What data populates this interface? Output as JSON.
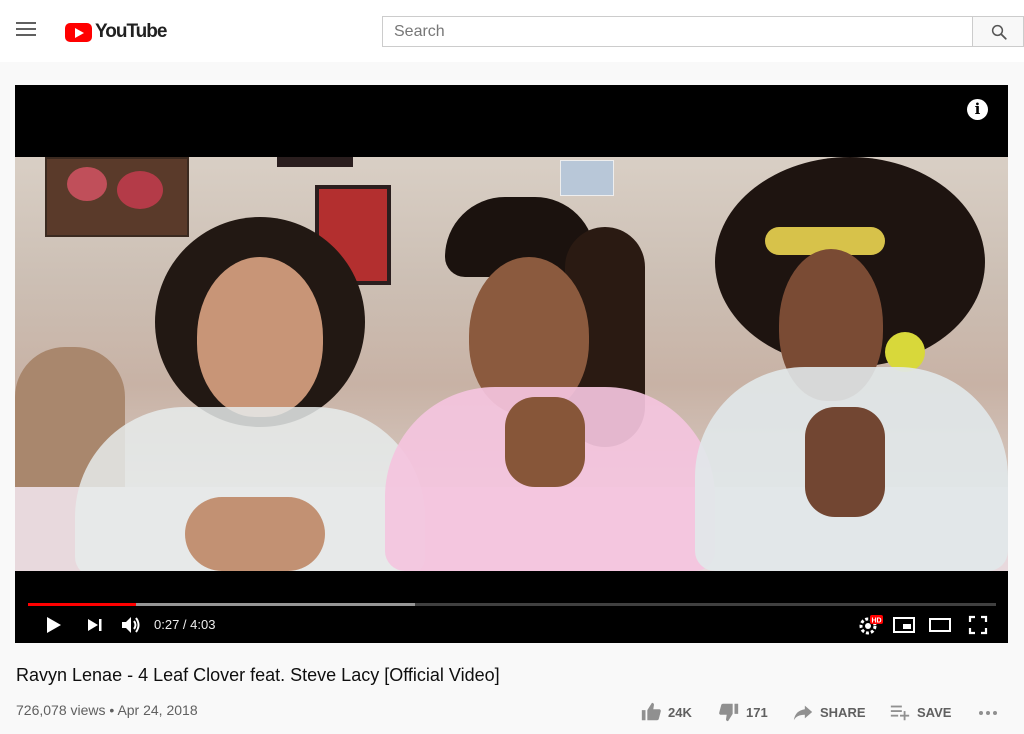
{
  "header": {
    "logo_text": "YouTube",
    "search_placeholder": "Search"
  },
  "player": {
    "current_time": "0:27",
    "duration": "4:03",
    "time_display": "0:27 / 4:03",
    "played_fraction": 0.1111,
    "buffered_fraction": 0.4,
    "settings_badge": "HD",
    "accent_color": "#ff0000"
  },
  "video": {
    "title": "Ravyn Lenae - 4 Leaf Clover feat. Steve Lacy [Official Video]",
    "views": "726,078 views",
    "separator": "•",
    "date": "Apr 24, 2018"
  },
  "actions": {
    "likes": "24K",
    "dislikes": "171",
    "share_label": "SHARE",
    "save_label": "SAVE"
  },
  "icons": [
    "menu-icon",
    "youtube-logo-icon",
    "search-icon",
    "info-icon",
    "play-icon",
    "next-icon",
    "volume-icon",
    "settings-icon",
    "miniplayer-icon",
    "theater-icon",
    "fullscreen-icon",
    "thumbs-up-icon",
    "thumbs-down-icon",
    "share-icon",
    "playlist-add-icon",
    "more-icon"
  ]
}
